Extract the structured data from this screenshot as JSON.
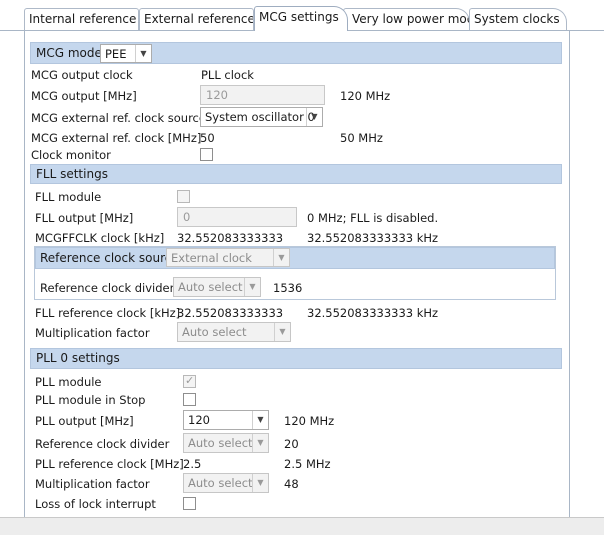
{
  "tabs": [
    {
      "label": "Internal reference cl"
    },
    {
      "label": "External reference cl"
    },
    {
      "label": "MCG settings"
    },
    {
      "label": "Very low power mode"
    },
    {
      "label": "System clocks"
    }
  ],
  "mcg": {
    "mode_label": "MCG mode",
    "mode_value": "PEE",
    "output_clock_label": "MCG output clock",
    "output_clock_value": "PLL clock",
    "output_mhz_label": "MCG output [MHz]",
    "output_mhz_value": "120",
    "output_mhz_unit": "120 MHz",
    "ext_source_label": "MCG external ref. clock source",
    "ext_source_value": "System oscillator 0",
    "ext_clock_label": "MCG external ref. clock [MHz]",
    "ext_clock_value": "50",
    "ext_clock_unit": "50 MHz",
    "clock_monitor_label": "Clock monitor"
  },
  "fll": {
    "title": "FLL settings",
    "module_label": "FLL module",
    "output_label": "FLL output [MHz]",
    "output_value": "0",
    "output_note": "0 MHz; FLL is disabled.",
    "mcgffclk_label": "MCGFFCLK clock [kHz]",
    "mcgffclk_value": "32.552083333333",
    "mcgffclk_unit": "32.552083333333 kHz",
    "ref_source_label": "Reference clock source",
    "ref_source_value": "External clock",
    "ref_divider_label": "Reference clock divider",
    "ref_divider_value": "Auto select",
    "ref_divider_result": "1536",
    "ref_clock_label": "FLL reference clock [kHz]",
    "ref_clock_value": "32.552083333333",
    "ref_clock_unit": "32.552083333333 kHz",
    "mult_label": "Multiplication factor",
    "mult_value": "Auto select"
  },
  "pll": {
    "title": "PLL 0 settings",
    "module_label": "PLL module",
    "stop_label": "PLL module in Stop",
    "output_label": "PLL output [MHz]",
    "output_value": "120",
    "output_unit": "120 MHz",
    "divider_label": "Reference clock divider",
    "divider_value": "Auto select",
    "divider_result": "20",
    "ref_clock_label": "PLL reference clock [MHz]",
    "ref_clock_value": "2.5",
    "ref_clock_unit": "2.5 MHz",
    "mult_label": "Multiplication factor",
    "mult_value": "Auto select",
    "mult_result": "48",
    "lol_label": "Loss of lock interrupt"
  }
}
